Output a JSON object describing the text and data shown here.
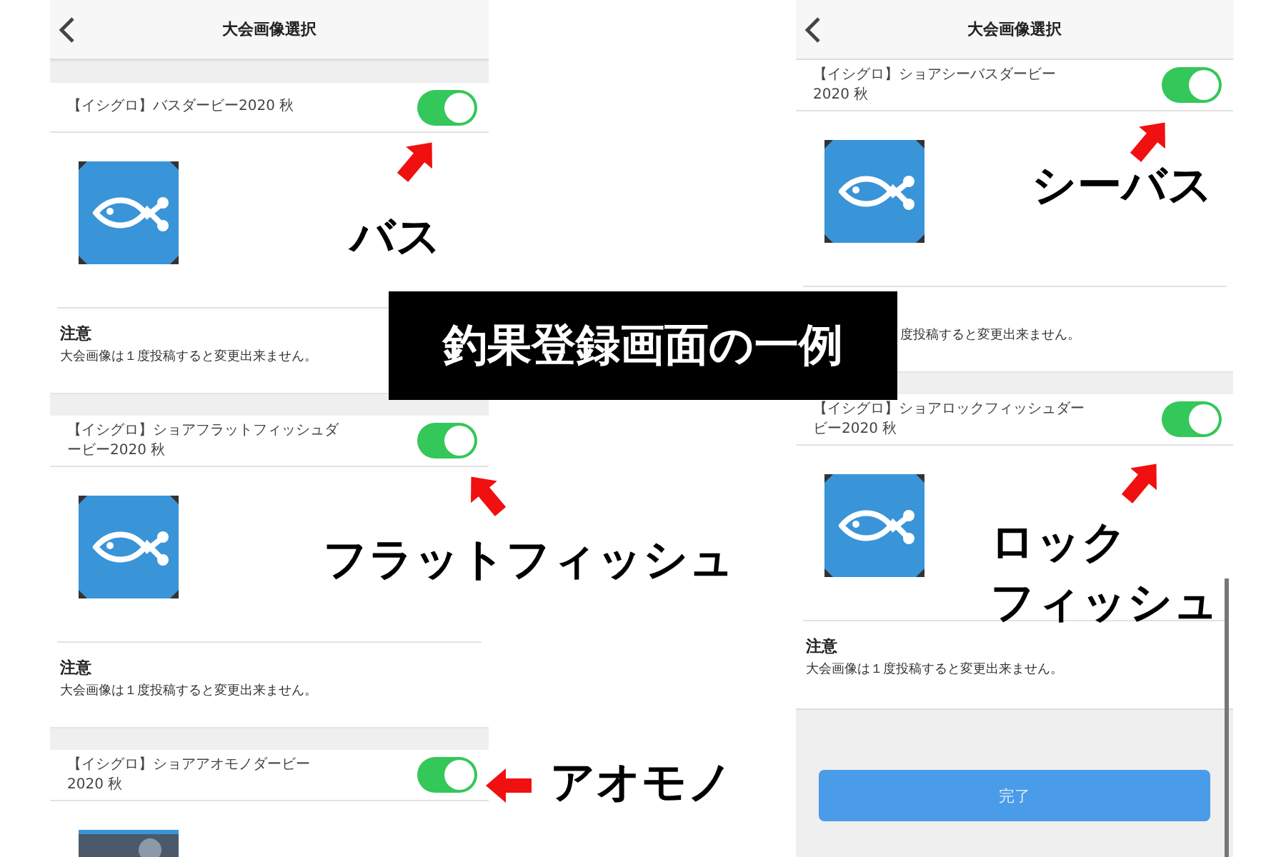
{
  "panels": [
    {
      "header": {
        "title": "大会画像選択"
      },
      "sections": [
        {
          "title": "【イシグロ】バスダービー2020 秋",
          "on": true,
          "image": {
            "kind": "fish-icon"
          },
          "note": {
            "title": "注意",
            "text": "大会画像は１度投稿すると変更出来ません。"
          }
        },
        {
          "title": "【イシグロ】ショアフラットフィッシュダービー2020 秋",
          "on": true,
          "image": {
            "kind": "fish-icon"
          },
          "note": {
            "title": "注意",
            "text": "大会画像は１度投稿すると変更出来ません。"
          }
        },
        {
          "title": "【イシグロ】ショアアオモノダービー2020 秋",
          "on": true
        }
      ]
    },
    {
      "header": {
        "title": "大会画像選択"
      },
      "sections": [
        {
          "title": "【イシグロ】ショアシーバスダービー2020 秋",
          "on": true,
          "image": {
            "kind": "fish-icon"
          },
          "note": {
            "text": "度投稿すると変更出来ません。"
          }
        },
        {
          "title": "【イシグロ】ショアロックフィッシュダービー2020 秋",
          "on": true,
          "image": {
            "kind": "fish-icon"
          },
          "note": {
            "title": "注意",
            "text": "大会画像は１度投稿すると変更出来ません。"
          }
        }
      ],
      "button": "完了"
    }
  ],
  "banner": "釣果登録画面の一例",
  "annotations": [
    {
      "lines": [
        "バス"
      ]
    },
    {
      "lines": [
        "フラットフィッシュ"
      ]
    },
    {
      "lines": [
        "アオモノ"
      ]
    },
    {
      "lines": [
        "シーバス"
      ]
    },
    {
      "lines": [
        "ロック",
        "フィッシュ"
      ]
    }
  ]
}
